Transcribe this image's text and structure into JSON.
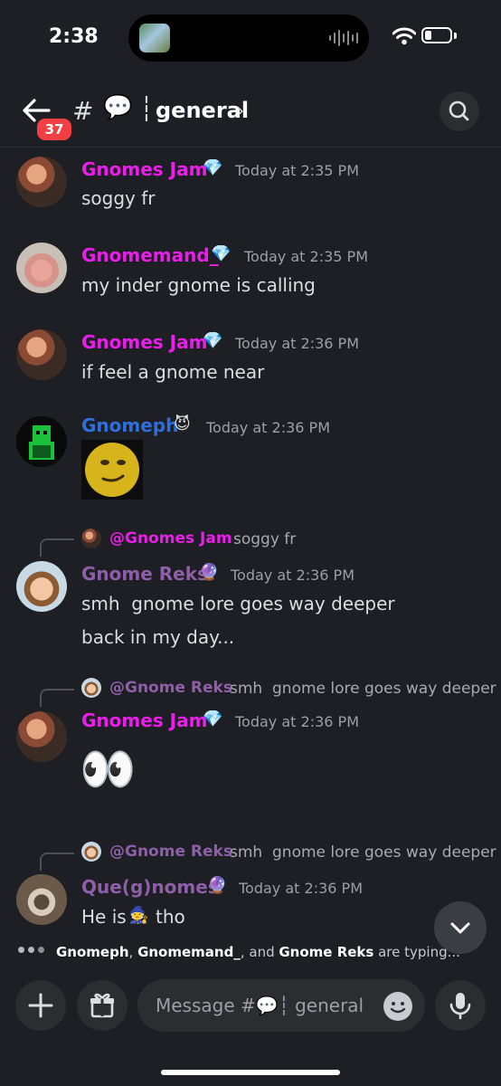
{
  "status_bar": {
    "time": "2:38"
  },
  "header": {
    "unread_count": "37",
    "hash": "#",
    "channel_emoji": "💬",
    "separator": "┆",
    "channel_name": "general",
    "chevron": "›"
  },
  "messages": [
    {
      "author": "Gnomes Jam",
      "color": "#e91ee8",
      "badge": "💎",
      "time": "Today at 2:35 PM",
      "lines": [
        "soggy fr"
      ]
    },
    {
      "author": "Gnomemand_",
      "color": "#e91ee8",
      "badge": "💎",
      "time": "Today at 2:35 PM",
      "lines": [
        "my inder gnome is calling"
      ]
    },
    {
      "author": "Gnomes Jam",
      "color": "#e91ee8",
      "badge": "💎",
      "time": "Today at 2:36 PM",
      "lines": [
        "if feel a gnome near"
      ]
    },
    {
      "author": "Gnomeph",
      "color": "#2f6fd9",
      "badge": "😈",
      "time": "Today at 2:36 PM",
      "lines": []
    },
    {
      "reply_to": "@Gnomes Jam",
      "reply_color": "#e91ee8",
      "reply_text": "soggy fr",
      "author": "Gnome Reks",
      "color": "#8e5fa8",
      "badge": "🔮",
      "time": "Today at 2:36 PM",
      "lines": [
        "smh  gnome lore goes way deeper",
        "back in my day..."
      ]
    },
    {
      "reply_to": "@Gnome Reks",
      "reply_color": "#8e5fa8",
      "reply_text": "smh  gnome lore goes way deeper",
      "author": "Gnomes Jam",
      "color": "#e91ee8",
      "badge": "💎",
      "time": "Today at 2:36 PM",
      "lines": [
        "👀"
      ]
    },
    {
      "reply_to": "@Gnome Reks",
      "reply_color": "#8e5fa8",
      "reply_text": "smh  gnome lore goes way deeper",
      "author": "Que(g)nomes",
      "color": "#8e5fa8",
      "badge": "🔮",
      "time": "Today at 2:36 PM",
      "lines": [
        "He is",
        "🧙",
        "tho"
      ]
    }
  ],
  "typing": {
    "names_1": "Gnomeph",
    "sep_1": ", ",
    "names_2": "Gnomemand_",
    "sep_2": ", and ",
    "names_3": "Gnome Reks",
    "suffix": " are typing..."
  },
  "composer": {
    "placeholder_prefix": "Message #",
    "placeholder_emoji": "💬",
    "placeholder_sep": "┆",
    "placeholder_name": " general"
  },
  "icons": [
    "back-arrow-icon",
    "search-icon",
    "plus-icon",
    "gift-icon",
    "emoji-icon",
    "microphone-icon",
    "chevron-down-icon",
    "wifi-icon",
    "battery-icon"
  ]
}
